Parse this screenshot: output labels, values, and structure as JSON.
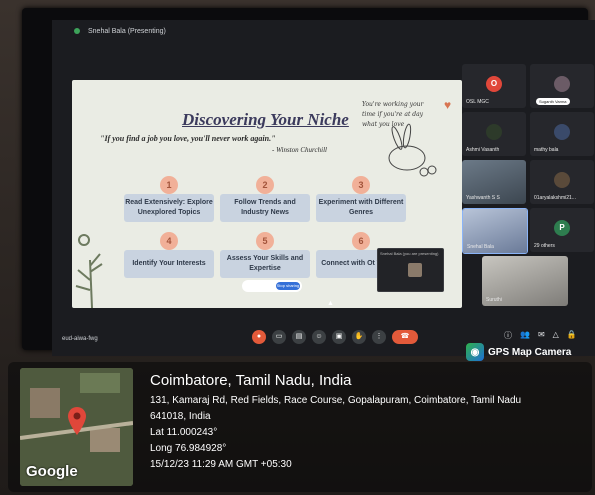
{
  "meeting": {
    "presenter_label": "Snehal Bala (Presenting)",
    "meeting_code": "eud-aiwa-fwg"
  },
  "slide": {
    "title": "Discovering Your Niche",
    "quote": "\"If you find a job you love, you'll never work again.\"",
    "author": "- Winston Churchill",
    "scribble": "You're working your time if you're at day what you love",
    "steps": [
      {
        "num": "1",
        "label": "Read Extensively: Explore Unexplored Topics"
      },
      {
        "num": "2",
        "label": "Follow Trends and Industry News"
      },
      {
        "num": "3",
        "label": "Experiment with Different Genres"
      },
      {
        "num": "4",
        "label": "Identify Your Interests"
      },
      {
        "num": "5",
        "label": "Assess Your Skills and Expertise"
      },
      {
        "num": "6",
        "label": "Connect with Ot Writers"
      }
    ],
    "stop_label": "Stop sharing"
  },
  "mini_preview": {
    "label": "Snehal Bala (you are presenting)"
  },
  "participants": [
    {
      "name": "OSL MGC",
      "initial": "O",
      "color": "#e0473a",
      "pill": ""
    },
    {
      "name": "",
      "initial": "",
      "color": "#6b5b66",
      "pill": "Suganth Varma"
    },
    {
      "name": "Ashmi Vasanth",
      "initial": "",
      "color": "#2d3a2a",
      "pill": ""
    },
    {
      "name": "mathy bala",
      "initial": "",
      "color": "#3a4a6a",
      "pill": ""
    },
    {
      "name": "Yashwanth S S",
      "initial": "",
      "color": "#4a5a6a",
      "pill": ""
    },
    {
      "name": "01aryalakshmi21...",
      "initial": "",
      "color": "#5a4a3a",
      "pill": ""
    },
    {
      "name": "Snehal Bala",
      "initial": "",
      "color": "#7a8aa8",
      "pill": ""
    },
    {
      "name": "29 others",
      "initial": "P",
      "color": "#2e7d4f",
      "pill": ""
    },
    {
      "name": "Suruthi",
      "initial": "",
      "color": "#8a8a88",
      "pill": ""
    }
  ],
  "overlay": {
    "app_name": "GPS Map Camera",
    "city": "Coimbatore, Tamil Nadu, India",
    "address": "131, Kamaraj Rd, Red Fields, Race Course, Gopalapuram, Coimbatore, Tamil Nadu",
    "postal": "641018, India",
    "lat": "Lat 11.000243°",
    "long": "Long 76.984928°",
    "timestamp": "15/12/23 11:29 AM GMT +05:30",
    "map_brand": "Google"
  }
}
